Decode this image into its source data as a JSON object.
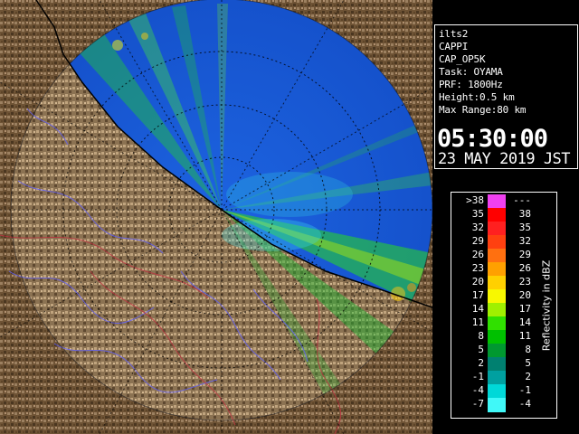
{
  "info": {
    "lines": [
      "ilts2",
      "CAPPI",
      "CAP_OP5K",
      "Task: OYAMA",
      "PRF: 1800Hz",
      "Height:0.5 km",
      "Max Range:80 km"
    ],
    "time": "05:30:00",
    "date": "23 MAY 2019 JST"
  },
  "legend": {
    "title": "Reflectivity in dBZ",
    "rows": [
      {
        "low": ">38",
        "high": "---",
        "color": "#f040f0"
      },
      {
        "low": "35",
        "high": "38",
        "color": "#ff0000"
      },
      {
        "low": "32",
        "high": "35",
        "color": "#ff2020"
      },
      {
        "low": "29",
        "high": "32",
        "color": "#ff4010"
      },
      {
        "low": "26",
        "high": "29",
        "color": "#ff7010"
      },
      {
        "low": "23",
        "high": "26",
        "color": "#ffa000"
      },
      {
        "low": "20",
        "high": "23",
        "color": "#ffd000"
      },
      {
        "low": "17",
        "high": "20",
        "color": "#f8f800"
      },
      {
        "low": "14",
        "high": "17",
        "color": "#a0f000"
      },
      {
        "low": "11",
        "high": "14",
        "color": "#30e000"
      },
      {
        "low": "8",
        "high": "11",
        "color": "#00c000"
      },
      {
        "low": "5",
        "high": "8",
        "color": "#009830"
      },
      {
        "low": "2",
        "high": "5",
        "color": "#008070"
      },
      {
        "low": "-1",
        "high": "2",
        "color": "#00a0a0"
      },
      {
        "low": "-4",
        "high": "-1",
        "color": "#00d8d8"
      },
      {
        "low": "-7",
        "high": "-4",
        "color": "#40f8f8"
      }
    ]
  },
  "colors": {
    "radar_blue": "#1a5cd8",
    "terrain": "#7a5f3e",
    "panel_border": "#ffffff"
  }
}
